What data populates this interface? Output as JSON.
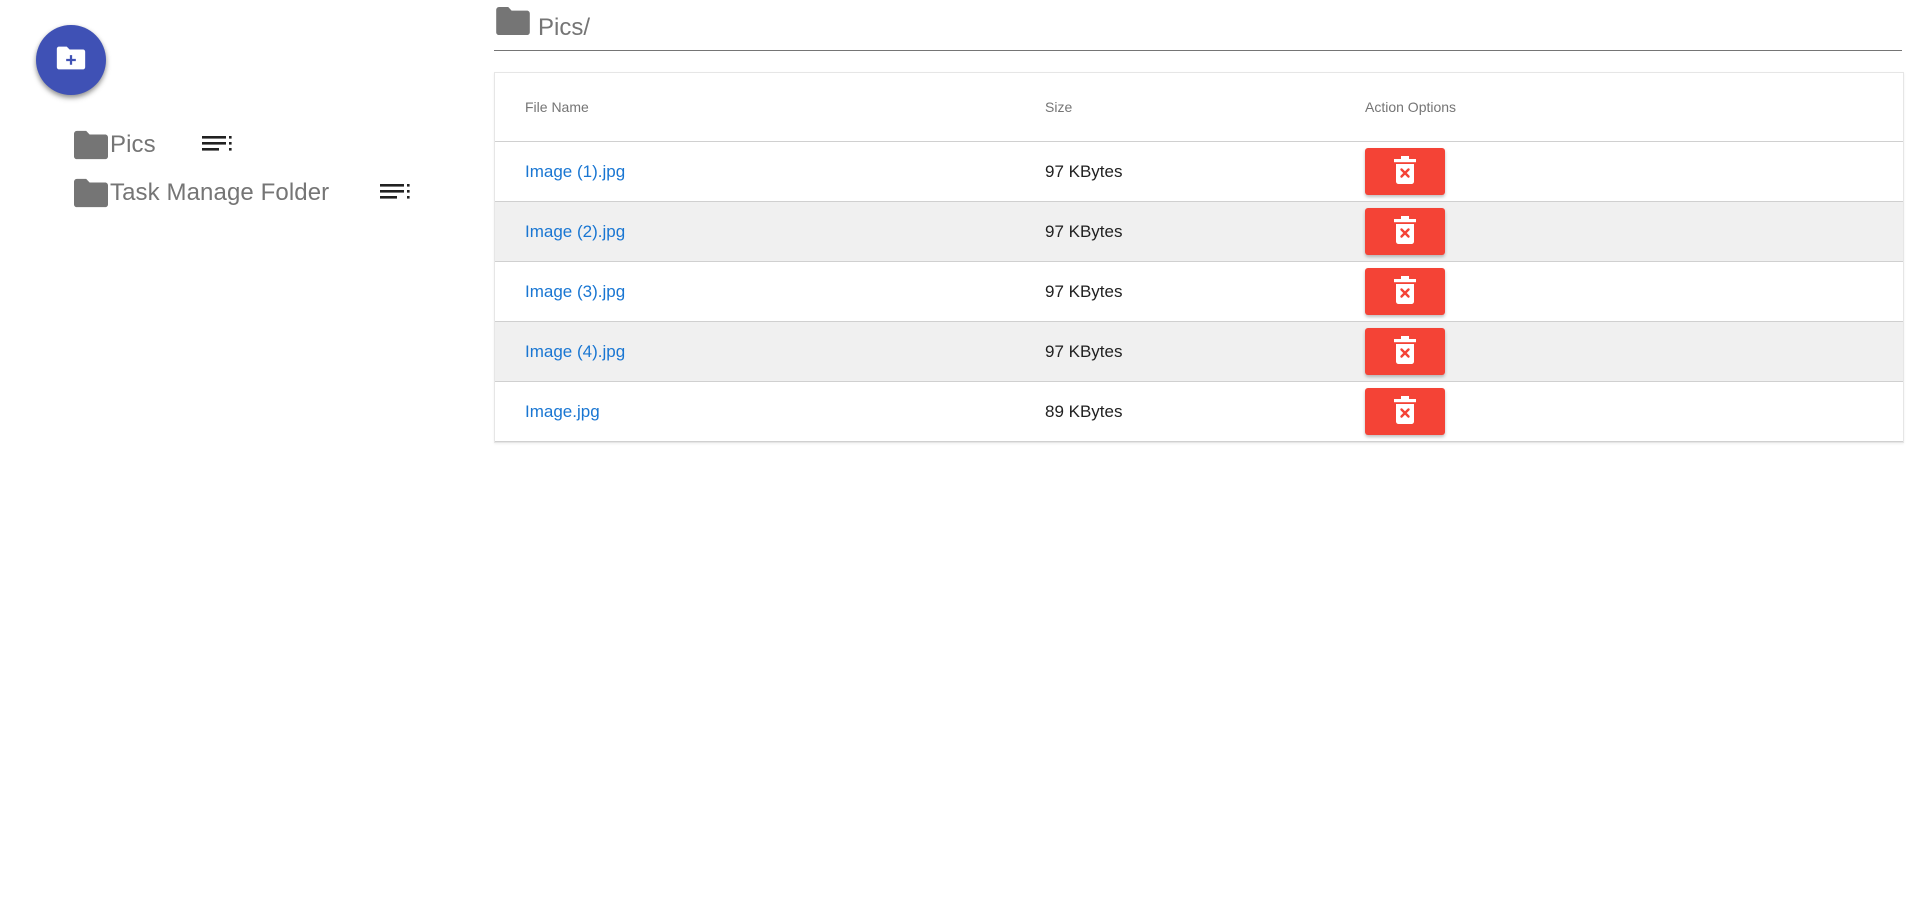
{
  "fab": {
    "icon": "folder-plus-icon",
    "color": "#3f51b5"
  },
  "sidebar": {
    "folders": [
      {
        "label": "Pics",
        "icon": "folder-icon",
        "menu_icon": "playlist-menu-icon"
      },
      {
        "label": "Task Manage Folder",
        "icon": "folder-icon",
        "menu_icon": "playlist-menu-icon"
      }
    ]
  },
  "main": {
    "path": "Pics/",
    "path_icon": "folder-icon",
    "table": {
      "headers": {
        "name": "File Name",
        "size": "Size",
        "actions": "Action Options"
      },
      "rows": [
        {
          "name": "Image (1).jpg",
          "size": "97 KBytes"
        },
        {
          "name": "Image (2).jpg",
          "size": "97 KBytes"
        },
        {
          "name": "Image (3).jpg",
          "size": "97 KBytes"
        },
        {
          "name": "Image (4).jpg",
          "size": "97 KBytes"
        },
        {
          "name": "Image.jpg",
          "size": "89 KBytes"
        }
      ],
      "delete_icon": "trash-x-icon",
      "delete_color": "#f44336",
      "link_color": "#1976d2"
    }
  }
}
